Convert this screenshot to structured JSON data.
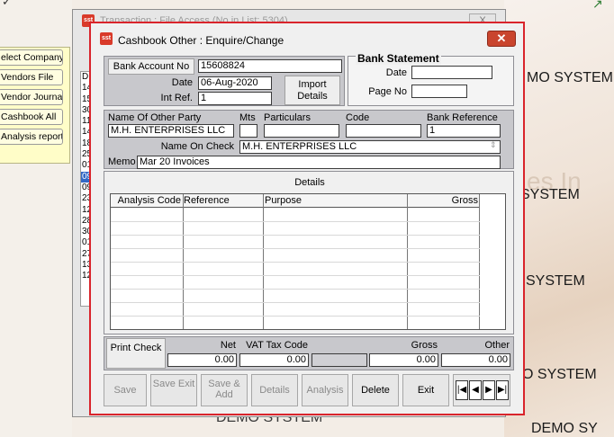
{
  "background": {
    "left_menu": [
      "elect Company",
      "Vendors File",
      "Vendor Journal",
      "Cashbook All",
      "Analysis report"
    ],
    "demo_labels": [
      "MO SYSTEM",
      "SYSTEM",
      "SYSTEM",
      "O SYSTEM",
      "DEMO SY"
    ],
    "faded_text": "es In",
    "bottom_faded": "DEMO SYSTEM"
  },
  "transaction_window": {
    "title": "Transaction : File Access     (No in List: 5304)",
    "close": "X",
    "list_items": [
      "D",
      "14",
      "15",
      "30",
      "11",
      "14",
      "18",
      "25",
      "01",
      "09",
      "09",
      "23",
      "12",
      "28",
      "30",
      "01",
      "27",
      "13",
      "12"
    ],
    "selected_index": 9
  },
  "dialog": {
    "title": "Cashbook Other : Enquire/Change",
    "icon_text": "sst",
    "close": "✕",
    "bank": {
      "account_label": "Bank Account No",
      "account_value": "15608824",
      "date_label": "Date",
      "date_value": "06-Aug-2020",
      "intref_label": "Int Ref.",
      "intref_value": "1",
      "import_label": "Import Details"
    },
    "statement": {
      "heading": "Bank Statement",
      "date_label": "Date",
      "date_value": "",
      "page_label": "Page No",
      "page_value": ""
    },
    "party": {
      "name_label": "Name Of Other Party",
      "name_value": "M.H. ENTERPRISES LLC",
      "mts_label": "Mts",
      "mts_value": "",
      "particulars_label": "Particulars",
      "particulars_value": "",
      "code_label": "Code",
      "code_value": "",
      "bankref_label": "Bank Reference",
      "bankref_value": "1",
      "oncheck_label": "Name On Check",
      "oncheck_value": "M.H. ENTERPRISES LLC",
      "memo_label": "Memo",
      "memo_value": "Mar 20 Invoices"
    },
    "details": {
      "heading": "Details",
      "columns": [
        "Analysis Code",
        "Reference",
        "Purpose",
        "Gross"
      ]
    },
    "totals": {
      "print_label": "Print Check",
      "net_label": "Net",
      "net_value": "0.00",
      "vat_label": "VAT Tax Code",
      "vat_value": "0.00",
      "taxcode_value": "",
      "gross_label": "Gross",
      "gross_value": "0.00",
      "other_label": "Other",
      "other_value": "0.00"
    },
    "buttons": {
      "save": "Save",
      "save_exit": "Save Exit",
      "save_add": "Save & Add",
      "details": "Details",
      "analysis": "Analysis",
      "delete": "Delete",
      "exit": "Exit",
      "nav": [
        "|◀",
        "◀",
        "▶",
        "▶|"
      ]
    }
  }
}
